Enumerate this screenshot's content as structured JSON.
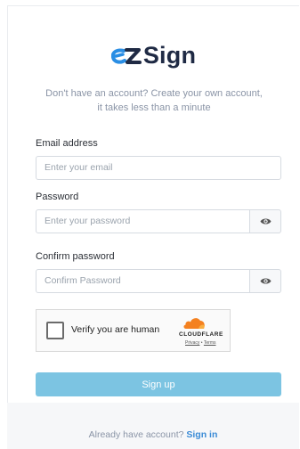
{
  "brand": {
    "name": "Sign",
    "mark": "eZ",
    "colors": {
      "mark_blue": "#2a8ee4",
      "text_dark": "#1f2a44"
    }
  },
  "subtitle": "Don't have an account? Create your own account, it takes less than a minute",
  "form": {
    "email": {
      "label": "Email address",
      "placeholder": "Enter your email"
    },
    "password": {
      "label": "Password",
      "placeholder": "Enter your password",
      "toggle_icon": "eye-icon"
    },
    "confirm": {
      "label": "Confirm password",
      "placeholder": "Confirm Password",
      "toggle_icon": "eye-icon"
    }
  },
  "captcha": {
    "label": "Verify you are human",
    "provider": "CLOUDFLARE",
    "privacy": "Privacy",
    "separator": "•",
    "terms": "Terms"
  },
  "submit": {
    "label": "Sign up",
    "color": "#7cc4e2"
  },
  "footer": {
    "text": "Already have account?",
    "link": "Sign in",
    "link_color": "#3a8bd6"
  }
}
